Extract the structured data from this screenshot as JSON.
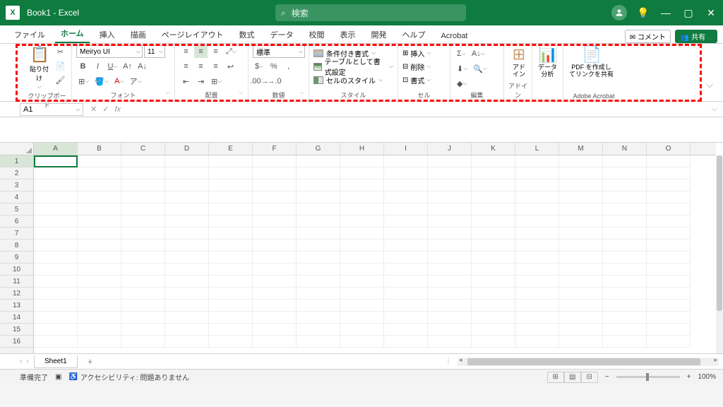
{
  "title": "Book1 - Excel",
  "search_placeholder": "検索",
  "tabs": {
    "items": [
      "ファイル",
      "ホーム",
      "挿入",
      "描画",
      "ページレイアウト",
      "数式",
      "データ",
      "校閲",
      "表示",
      "開発",
      "ヘルプ",
      "Acrobat"
    ],
    "active_index": 1,
    "comment_btn": "コメント",
    "share_btn": "共有"
  },
  "ribbon": {
    "clipboard": {
      "paste": "貼り付け",
      "label": "クリップボード"
    },
    "font": {
      "name": "Meiryo UI",
      "size": "11",
      "label": "フォント"
    },
    "alignment": {
      "label": "配置"
    },
    "number": {
      "format": "標準",
      "label": "数値"
    },
    "styles": {
      "cond_format": "条件付き書式",
      "as_table": "テーブルとして書式設定",
      "cell_styles": "セルのスタイル",
      "label": "スタイル"
    },
    "cells": {
      "insert": "挿入",
      "delete": "削除",
      "format": "書式",
      "label": "セル"
    },
    "editing": {
      "label": "編集"
    },
    "addins": {
      "addin": "アド\nイン",
      "label": "アドイン"
    },
    "analysis": {
      "data": "データ\n分析"
    },
    "acrobat": {
      "pdf": "PDF を作成し\nてリンクを共有",
      "label": "Adobe Acrobat"
    }
  },
  "namebox": "A1",
  "columns": [
    "A",
    "B",
    "C",
    "D",
    "E",
    "F",
    "G",
    "H",
    "I",
    "J",
    "K",
    "L",
    "M",
    "N",
    "O"
  ],
  "rows_visible": 16,
  "sheet_tab": "Sheet1",
  "status": {
    "ready": "準備完了",
    "accessibility": "アクセシビリティ: 問題ありません",
    "zoom": "100%"
  }
}
